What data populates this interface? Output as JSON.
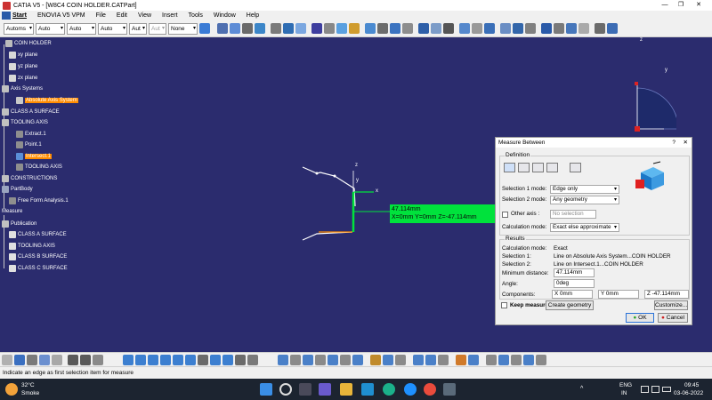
{
  "titlebar": {
    "title": "CATIA V5 - [W8C4 COIN HOLDER.CATPart]",
    "minimize": "—",
    "maximize": "❐",
    "close": "✕"
  },
  "menubar": {
    "items": [
      "Start",
      "ENOVIA V5 VPM",
      "File",
      "Edit",
      "View",
      "Insert",
      "Tools",
      "Window",
      "Help"
    ]
  },
  "toolbar": {
    "selects": [
      "Automs",
      "Auto",
      "Auto",
      "Auto",
      "Aut",
      "Aut",
      "None"
    ]
  },
  "tree": {
    "root": "COIN HOLDER",
    "xy": "xy plane",
    "yz": "yz plane",
    "zx": "zx plane",
    "axis_systems": "Axis Systems",
    "absolute_axis": "Absolute Axis System",
    "class_a": "CLASS A SURFACE",
    "tooling_axis": "TOOLING AXIS",
    "extract": "Extract.1",
    "point": "Point.1",
    "intersect": "Intersect.1",
    "tooling_axis_2": "TOOLING AXIS",
    "constructions": "CONSTRUCTIONS",
    "partbody": "PartBody",
    "freeform": "Free Form Analysis.1",
    "measure": "Measure",
    "publication": "Publication",
    "pub_class_a": "CLASS A SURFACE",
    "pub_tooling": "TOOLING AXIS",
    "pub_class_b": "CLASS B SURFACE",
    "pub_class_c": "CLASS C SURFACE"
  },
  "viewport": {
    "compass_z": "z",
    "compass_y": "y",
    "axis_x": "x",
    "axis_y": "y",
    "axis_z": "z",
    "measure_value": "47.114mm",
    "measure_components": "X=0mm  Y=0mm  Z=-47.114mm"
  },
  "dialog": {
    "title": "Measure Between",
    "help": "?",
    "close": "✕",
    "definition_label": "Definition",
    "selection1_label": "Selection 1 mode:",
    "selection1_value": "Edge only",
    "selection2_label": "Selection 2 mode:",
    "selection2_value": "Any geometry",
    "other_axis_label": "Other axis :",
    "other_axis_value": "No selection",
    "calc_mode_label": "Calculation mode:",
    "calc_mode_value": "Exact else approximate",
    "results_label": "Results",
    "res_calc_label": "Calculation mode:",
    "res_calc_value": "Exact",
    "res_sel1_label": "Selection 1:",
    "res_sel1_value": "Line on Absolute Axis System...COIN HOLDER",
    "res_sel2_label": "Selection 2:",
    "res_sel2_value": "Line on Intersect.1...COIN HOLDER",
    "min_dist_label": "Minimum distance:",
    "min_dist_value": "47.114mm",
    "angle_label": "Angle:",
    "angle_value": "0deg",
    "components_label": "Components:",
    "comp_x": "X 0mm",
    "comp_y": "Y 0mm",
    "comp_z": "Z -47.114mm",
    "keep_measure": "Keep measure",
    "create_geometry": "Create geometry",
    "customize": "Customize...",
    "ok": "OK",
    "cancel": "Cancel"
  },
  "statusbar": {
    "message": "Indicate an edge as first selection item for measure"
  },
  "taskbar": {
    "temperature": "32°C",
    "weather": "Smoke",
    "lang1": "ENG",
    "lang2": "IN",
    "time": "09:45",
    "date": "03-06-2022"
  },
  "colors": {
    "viewport_bg": "#2b2c6e",
    "highlight": "#ff8c00",
    "measure_green": "#00e23c"
  }
}
